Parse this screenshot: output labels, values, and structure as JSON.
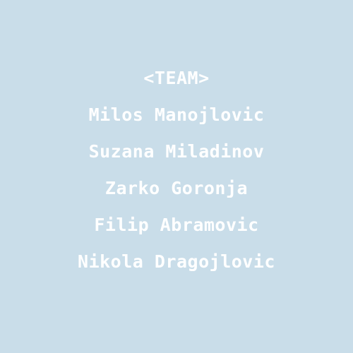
{
  "credits": {
    "heading": "<TEAM>",
    "members": [
      "Milos Manojlovic",
      "Suzana Miladinov",
      "Zarko Goronja",
      "Filip Abramovic",
      "Nikola Dragojlovic"
    ]
  },
  "colors": {
    "background": "#c9dde9",
    "text": "#ffffff"
  }
}
